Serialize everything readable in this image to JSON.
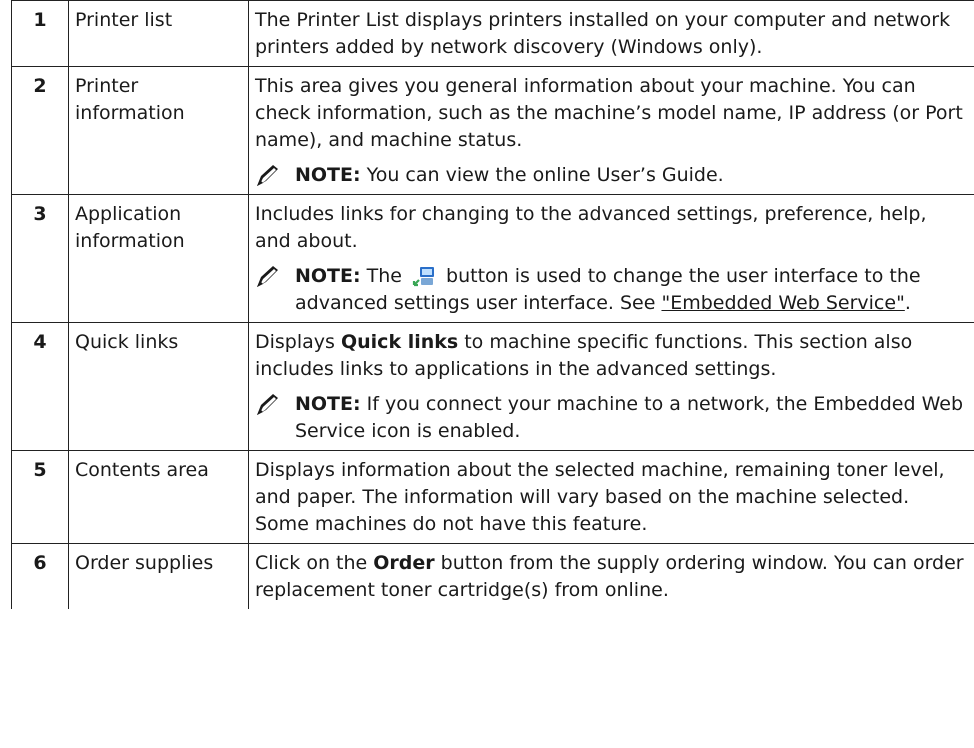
{
  "rows": [
    {
      "number": "1",
      "label": "Printer list",
      "description": "The Printer List displays printers installed on your computer and network printers added by network discovery (Windows only)."
    },
    {
      "number": "2",
      "label": "Printer information",
      "description": "This area gives you general information about your machine. You can check information, such as the machine’s model name, IP address (or Port name), and machine status.",
      "note_prefix": "NOTE:",
      "note_text": " You can view the online User’s Guide."
    },
    {
      "number": "3",
      "label": "Application information",
      "description": "Includes links for changing to the advanced settings, preference, help, and about.",
      "note_prefix": "NOTE:",
      "note_text_a": " The ",
      "note_text_b": " button is used to change the user interface to the advanced settings user interface. See ",
      "note_link": "\"Embedded Web Service\"",
      "note_text_c": "."
    },
    {
      "number": "4",
      "label": "Quick links",
      "description_a": "Displays ",
      "description_bold": "Quick links",
      "description_b": " to machine specific functions. This section also includes links to applications in the advanced settings.",
      "note_prefix": "NOTE:",
      "note_text": " If you connect your machine to a network, the Embedded Web Service icon is enabled."
    },
    {
      "number": "5",
      "label": "Contents area",
      "description": "Displays information about the selected machine, remaining toner level, and paper. The information will vary based on the machine selected. Some machines do not have this feature."
    },
    {
      "number": "6",
      "label": "Order supplies",
      "description_a": "Click on the ",
      "description_bold": "Order",
      "description_b": " button from the supply ordering window. You can order replacement toner cartridge(s) from online."
    }
  ],
  "icons": {
    "note": "pencil-note-icon",
    "button": "advanced-settings-switch-icon"
  },
  "colors": {
    "text": "#1a1a1a",
    "border": "#222222",
    "icon_blue": "#2a6fc9",
    "icon_green": "#3aa655"
  }
}
